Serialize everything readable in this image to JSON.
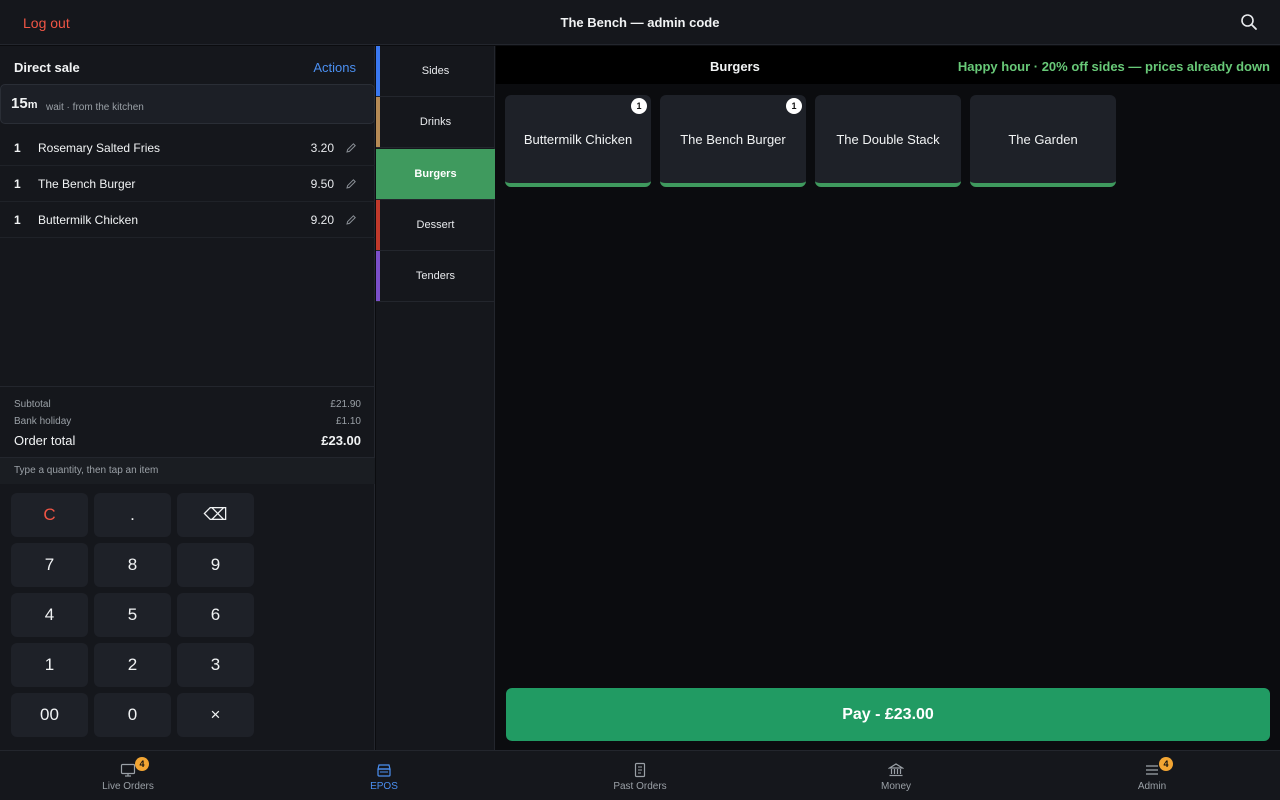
{
  "topbar": {
    "logout_label": "Log out",
    "title": "The Bench — admin code",
    "search_icon": "search-icon"
  },
  "sale": {
    "title": "Direct sale",
    "actions_label": "Actions",
    "wait_value": "15",
    "wait_unit": "m",
    "wait_text": "wait · from the kitchen",
    "items": [
      {
        "qty": "1",
        "name": "Rosemary Salted Fries",
        "price": "3.20"
      },
      {
        "qty": "1",
        "name": "The Bench Burger",
        "price": "9.50"
      },
      {
        "qty": "1",
        "name": "Buttermilk Chicken",
        "price": "9.20"
      }
    ],
    "totals": {
      "subtotal_label": "Subtotal",
      "subtotal_value": "£21.90",
      "holiday_label": "Bank holiday",
      "holiday_value": "£1.10",
      "total_label": "Order total",
      "total_value": "£23.00"
    },
    "hint": "Type a quantity, then tap an item"
  },
  "keypad": {
    "keys": [
      "C",
      ".",
      "⌫",
      "7",
      "8",
      "9",
      "4",
      "5",
      "6",
      "1",
      "2",
      "3",
      "00",
      "0",
      "×"
    ]
  },
  "categories": [
    {
      "label": "Sides",
      "color": "#3a78f0"
    },
    {
      "label": "Drinks",
      "color": "#b58a55"
    },
    {
      "label": "Burgers",
      "color": "#3f9a5e"
    },
    {
      "label": "Dessert",
      "color": "#c0392b"
    },
    {
      "label": "Tenders",
      "color": "#7b4fc9"
    }
  ],
  "active_category": "Burgers",
  "main": {
    "title": "Burgers",
    "promo": "Happy hour · 20% off sides — prices already down",
    "products": [
      {
        "name": "Buttermilk Chicken",
        "badge": "1"
      },
      {
        "name": "The Bench Burger",
        "badge": "1"
      },
      {
        "name": "The Double Stack",
        "badge": ""
      },
      {
        "name": "The Garden",
        "badge": ""
      }
    ],
    "pay_label": "Pay - £23.00"
  },
  "nav": [
    {
      "label": "Live Orders",
      "icon": "monitor-icon",
      "badge": "4"
    },
    {
      "label": "EPOS",
      "icon": "register-icon",
      "badge": ""
    },
    {
      "label": "Past Orders",
      "icon": "receipt-icon",
      "badge": ""
    },
    {
      "label": "Money",
      "icon": "bank-icon",
      "badge": ""
    },
    {
      "label": "Admin",
      "icon": "menu-icon",
      "badge": "4"
    }
  ],
  "nav_active": "EPOS",
  "colors": {
    "accent_blue": "#4b8ff0",
    "danger_red": "#f05545",
    "success_green": "#219b63",
    "badge_orange": "#f2a533"
  }
}
